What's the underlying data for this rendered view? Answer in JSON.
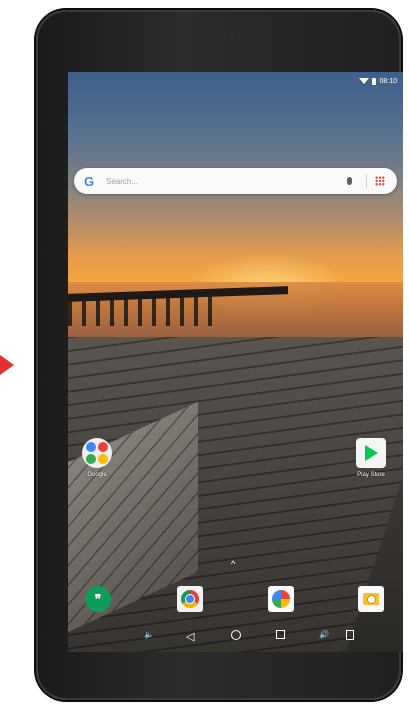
{
  "status_bar": {
    "time": "08:10",
    "icons": [
      "wifi-icon",
      "battery-icon"
    ]
  },
  "search": {
    "placeholder": "Search...",
    "logo_letter": "G"
  },
  "home_apps": [
    {
      "label": "Google",
      "icon": "google-folder-icon"
    },
    {
      "label": "Play Store",
      "icon": "play-store-icon"
    }
  ],
  "dock": [
    {
      "label": "",
      "icon": "hangouts-icon",
      "glyph": "❞"
    },
    {
      "label": "",
      "icon": "chrome-icon"
    },
    {
      "label": "",
      "icon": "photos-icon"
    },
    {
      "label": "",
      "icon": "camera-icon"
    }
  ],
  "dock_handle": "^",
  "nav": {
    "vol_down": "🔈",
    "back": "◁",
    "vol_up": "🔊"
  },
  "colors": {
    "accent_arrow": "#e53030",
    "hangouts": "#0f9d58",
    "play_store": "#00c853"
  }
}
